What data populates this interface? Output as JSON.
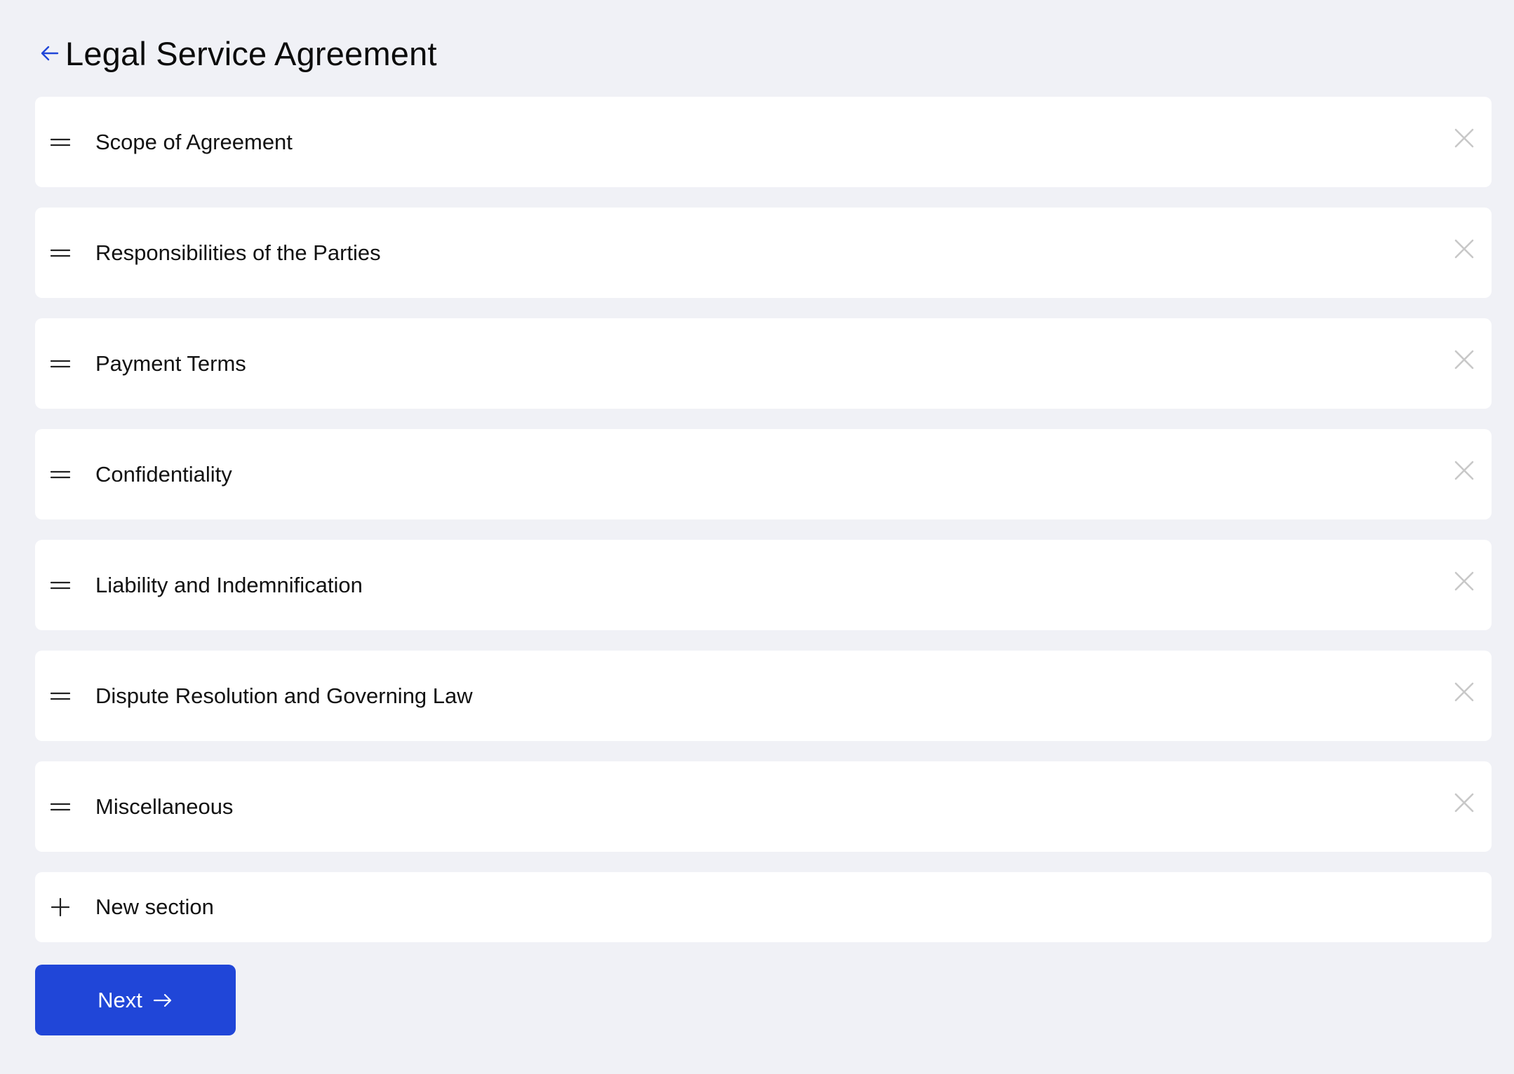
{
  "header": {
    "back_icon": "arrow-left-icon",
    "title": "Legal Service Agreement"
  },
  "sections": [
    {
      "label": "Scope of Agreement"
    },
    {
      "label": "Responsibilities of the Parties"
    },
    {
      "label": "Payment Terms"
    },
    {
      "label": "Confidentiality"
    },
    {
      "label": "Liability and Indemnification"
    },
    {
      "label": "Dispute Resolution and Governing Law"
    },
    {
      "label": "Miscellaneous"
    }
  ],
  "new_section": {
    "icon": "plus-icon",
    "label": "New section"
  },
  "next_button": {
    "label": "Next",
    "icon": "arrow-right-icon"
  },
  "colors": {
    "background": "#f0f1f6",
    "card": "#ffffff",
    "accent": "#2046d8",
    "close_icon": "#c8c8c8"
  }
}
